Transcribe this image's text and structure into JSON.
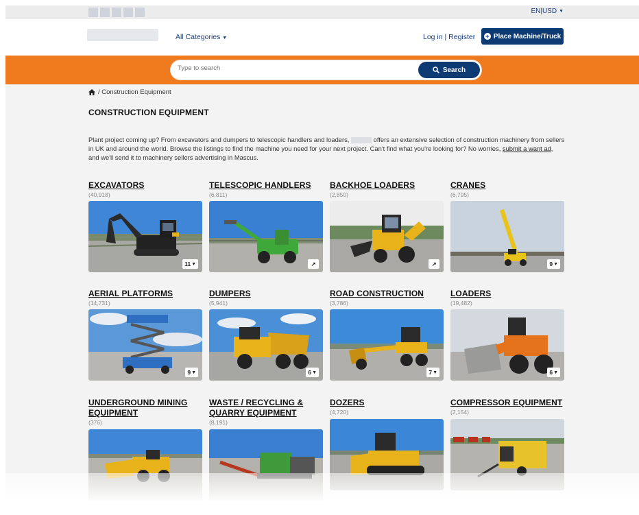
{
  "topbar": {
    "language": "EN|USD"
  },
  "header": {
    "all_categories": "All Categories",
    "login": "Log in | Register",
    "place_button": "Place Machine/Truck"
  },
  "search": {
    "placeholder": "Type to search",
    "button": "Search"
  },
  "breadcrumb": {
    "current": "/ Construction Equipment"
  },
  "page": {
    "title": "CONSTRUCTION EQUIPMENT",
    "intro_a": "Plant project coming up? From excavators and dumpers to telescopic handlers and loaders,",
    "intro_b": "offers an extensive selection of construction machinery from sellers in UK and around the world. Browse the listings to find the machine you need for your next project. Can't find what you're looking for? No worries,",
    "intro_link": "submit a want ad",
    "intro_c": ", and we'll send it to machinery sellers advertising in Mascus."
  },
  "categories": [
    {
      "title": "EXCAVATORS",
      "count": "(40,918)",
      "badge": "11",
      "badge_type": "dropdown",
      "icon": "excavator-image"
    },
    {
      "title": "TELESCOPIC HANDLERS",
      "count": "(6,811)",
      "badge": "",
      "badge_type": "link",
      "icon": "telehandler-image"
    },
    {
      "title": "BACKHOE LOADERS",
      "count": "(2,850)",
      "badge": "",
      "badge_type": "link",
      "icon": "backhoe-image"
    },
    {
      "title": "CRANES",
      "count": "(6,795)",
      "badge": "9",
      "badge_type": "dropdown",
      "icon": "crane-image"
    },
    {
      "title": "AERIAL PLATFORMS",
      "count": "(14,731)",
      "badge": "9",
      "badge_type": "dropdown",
      "icon": "scissor-lift-image"
    },
    {
      "title": "DUMPERS",
      "count": "(5,941)",
      "badge": "6",
      "badge_type": "dropdown",
      "icon": "dumper-image"
    },
    {
      "title": "ROAD CONSTRUCTION",
      "count": "(3,786)",
      "badge": "7",
      "badge_type": "dropdown",
      "icon": "grader-image"
    },
    {
      "title": "LOADERS",
      "count": "(19,482)",
      "badge": "6",
      "badge_type": "dropdown",
      "icon": "wheel-loader-image"
    },
    {
      "title": "UNDERGROUND MINING EQUIPMENT",
      "count": "(376)",
      "badge": "",
      "badge_type": "none",
      "icon": "mining-loader-image"
    },
    {
      "title": "WASTE / RECYCLING & QUARRY EQUIPMENT",
      "count": "(8,191)",
      "badge": "",
      "badge_type": "none",
      "icon": "screener-image"
    },
    {
      "title": "DOZERS",
      "count": "(4,720)",
      "badge": "",
      "badge_type": "none",
      "icon": "dozer-image"
    },
    {
      "title": "COMPRESSOR EQUIPMENT",
      "count": "(2,154)",
      "badge": "",
      "badge_type": "none",
      "icon": "compressor-image"
    }
  ],
  "colors": {
    "brand_navy": "#0e3a73",
    "brand_orange": "#f07a1e",
    "machine_yellow": "#e8b21a"
  }
}
